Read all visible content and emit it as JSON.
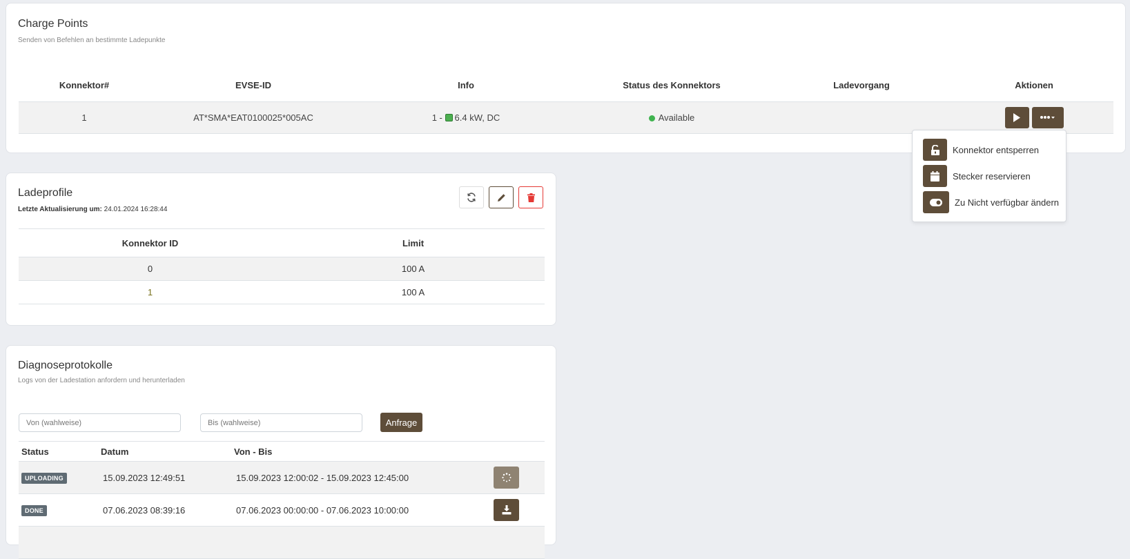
{
  "charge_points": {
    "title": "Charge Points",
    "subtitle": "Senden von Befehlen an bestimmte Ladepunkte",
    "columns": [
      "Konnektor#",
      "EVSE-ID",
      "Info",
      "Status des Konnektors",
      "Ladevorgang",
      "Aktionen"
    ],
    "rows": [
      {
        "connector": "1",
        "evse_id": "AT*SMA*EAT0100025*005AC",
        "info_prefix": "1 -",
        "info_power": "6.4 kW, DC",
        "status": "Available",
        "charging": ""
      }
    ],
    "status_color": "#3fb34f"
  },
  "dropdown": {
    "items": [
      {
        "label": "Konnektor entsperren",
        "icon": "unlock-icon"
      },
      {
        "label": "Stecker reservieren",
        "icon": "calendar-icon"
      },
      {
        "label": "Zu Nicht verfügbar ändern",
        "icon": "toggle-icon"
      }
    ]
  },
  "ladeprofile": {
    "title": "Ladeprofile",
    "updated_label": "Letzte Aktualisierung um:",
    "updated_value": "24.01.2024 16:28:44",
    "columns": [
      "Konnektor ID",
      "Limit"
    ],
    "rows": [
      {
        "id": "0",
        "limit": "100 A"
      },
      {
        "id": "1",
        "limit": "100 A"
      }
    ]
  },
  "diagnose": {
    "title": "Diagnoseprotokolle",
    "subtitle": "Logs von der Ladestation anfordern und herunterladen",
    "from_placeholder": "Von (wahlweise)",
    "to_placeholder": "Bis (wahlweise)",
    "request_label": "Anfrage",
    "columns": [
      "Status",
      "Datum",
      "Von - Bis"
    ],
    "rows": [
      {
        "status": "UPLOADING",
        "date": "15.09.2023 12:49:51",
        "range": "15.09.2023 12:00:02 - 15.09.2023 12:45:00",
        "action": "spinner-icon"
      },
      {
        "status": "DONE",
        "date": "07.06.2023 08:39:16",
        "range": "07.06.2023 00:00:00 - 07.06.2023 10:00:00",
        "action": "download-icon"
      }
    ]
  },
  "colors": {
    "accent": "#5e4d39",
    "accent_disabled": "#8f8372",
    "danger": "#e53935",
    "badge": "#5f6b73"
  }
}
